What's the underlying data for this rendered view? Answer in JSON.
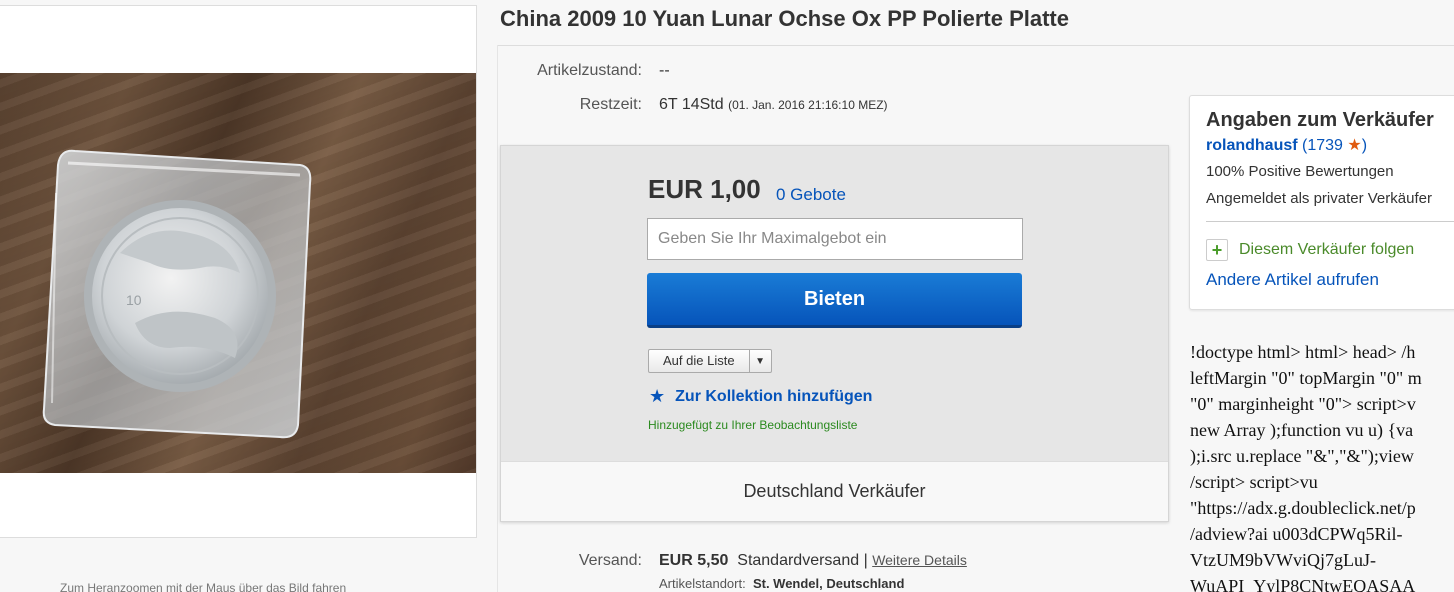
{
  "title": "China 2009 10 Yuan Lunar Ochse Ox PP Polierte Platte",
  "image": {
    "zoom_hint": "Zum Heranzoomen mit der Maus über das Bild fahren"
  },
  "details": {
    "condition_label": "Artikelzustand:",
    "condition_value": "--",
    "time_label": "Restzeit:",
    "time_value": "6T 14Std",
    "time_end": "(01. Jan. 2016  21:16:10 MEZ)"
  },
  "bid": {
    "price": "EUR 1,00",
    "bids_count": "0 Gebote",
    "max_bid_placeholder": "Geben Sie Ihr Maximalgebot ein",
    "bid_button": "Bieten",
    "watchlist_button": "Auf die Liste",
    "collection_link": "Zur Kollektion hinzufügen",
    "added_note": "Hinzugefügt zu Ihrer Beobachtungsliste",
    "footer": "Deutschland Verkäufer"
  },
  "shipping": {
    "label": "Versand:",
    "cost": "EUR 5,50",
    "method": "Standardversand |",
    "details_link": "Weitere Details",
    "location_label": "Artikelstandort:",
    "location_value": "St. Wendel, Deutschland"
  },
  "seller": {
    "heading": "Angaben zum Verkäufer",
    "name": "rolandhausf",
    "score_open": "(",
    "score": "1739",
    "score_close": ")",
    "positive": "100% Positive Bewertungen",
    "type": "Angemeldet als privater Verkäufer",
    "follow": "Diesem Verkäufer folgen",
    "other_items": "Andere Artikel aufrufen"
  },
  "raw_code_lines": [
    "!doctype html> html> head> /h",
    "leftMargin \"0\" topMargin \"0\" m",
    "\"0\" marginheight \"0\"> script>v",
    "new Array );function vu u) {va",
    ");i.src u.replace \"&\",\"&\");view",
    "/script> script>vu",
    "\"https://adx.g.doubleclick.net/p",
    "/adview?ai u003dCPWq5Ril-",
    "VtzUM9bVWviQj7gLuJ-",
    "WuAPI_YylP8CNtwEQASAA"
  ],
  "colors": {
    "link": "#0654ba",
    "bid_button": "#0654ba",
    "follow_green": "#4a8a2a",
    "star": "#e05a10"
  }
}
